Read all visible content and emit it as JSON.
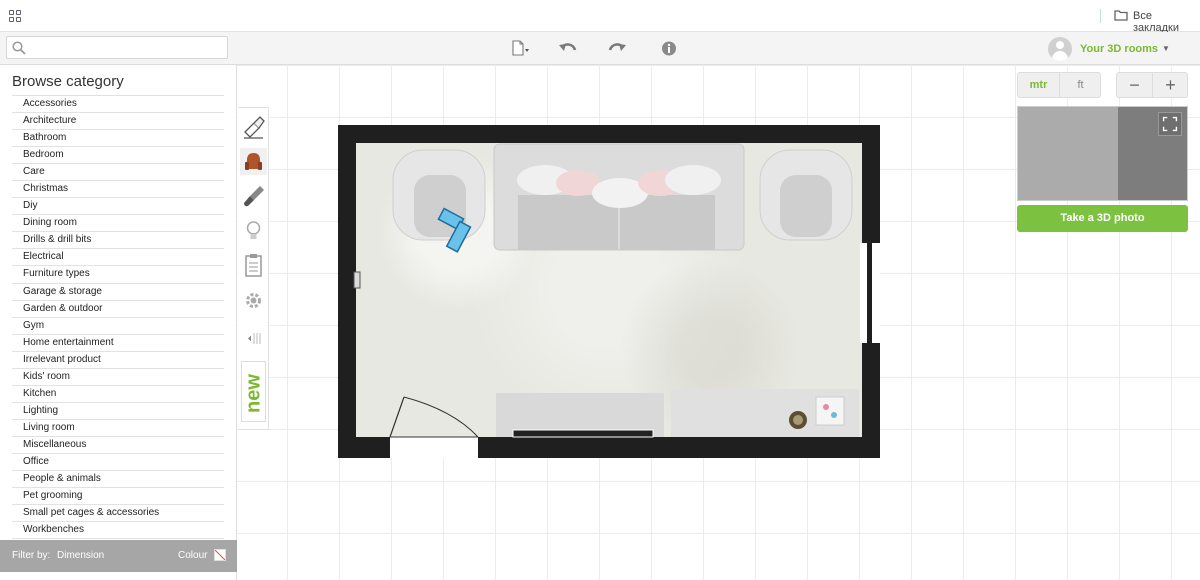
{
  "browser": {
    "bookmarks_folder_label": "Все закладки"
  },
  "toolbar": {
    "search_placeholder": "",
    "new_file_icon": "new-file-icon",
    "undo_icon": "undo-icon",
    "redo_icon": "redo-icon",
    "info_icon": "info-icon",
    "account_label": "Your 3D rooms"
  },
  "sidebar": {
    "title": "Browse category",
    "categories": [
      "Accessories",
      "Architecture",
      "Bathroom",
      "Bedroom",
      "Care",
      "Christmas",
      "Diy",
      "Dining room",
      "Drills & drill bits",
      "Electrical",
      "Furniture types",
      "Garage & storage",
      "Garden & outdoor",
      "Gym",
      "Home entertainment",
      "Irrelevant product",
      "Kids' room",
      "Kitchen",
      "Lighting",
      "Living room",
      "Miscellaneous",
      "Office",
      "People & animals",
      "Pet grooming",
      "Small pet cages & accessories",
      "Workbenches"
    ],
    "filter": {
      "label": "Filter by:",
      "dimension": "Dimension",
      "colour": "Colour"
    }
  },
  "tools": {
    "new_label": "new"
  },
  "right_panel": {
    "unit_metric": "mtr",
    "unit_feet": "ft",
    "zoom_out": "−",
    "zoom_in": "+",
    "photo_button": "Take a 3D photo"
  },
  "colors": {
    "accent_green": "#7cb832",
    "photo_button": "#7cc240",
    "wall": "#1f1f1f"
  }
}
